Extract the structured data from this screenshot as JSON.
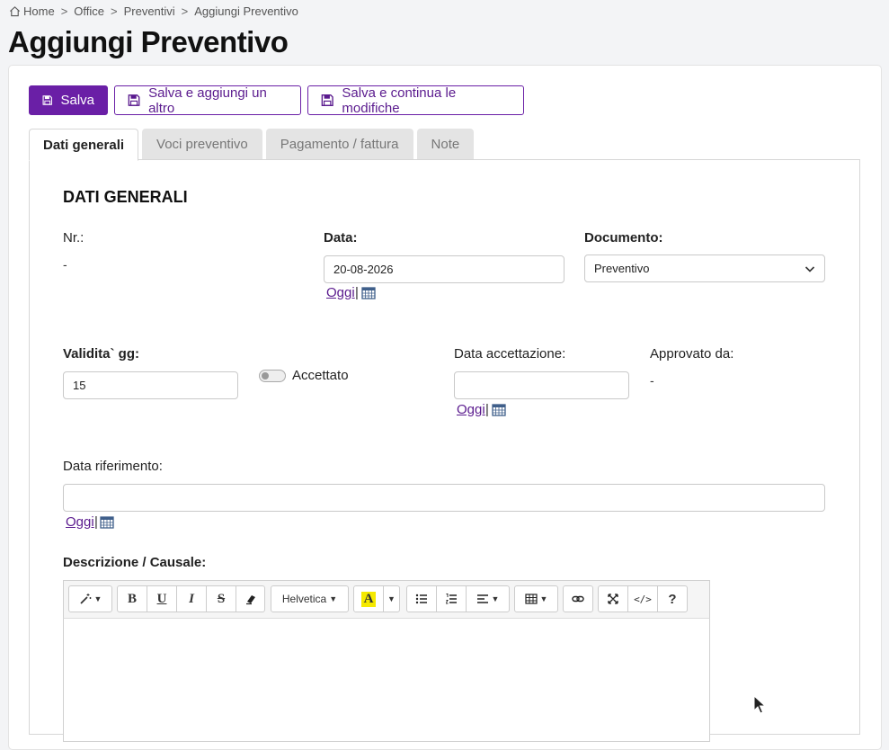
{
  "breadcrumb": [
    "Home",
    "Office",
    "Preventivi",
    "Aggiungi Preventivo"
  ],
  "page_title": "Aggiungi Preventivo",
  "actions": {
    "save": "Salva",
    "save_add": "Salva e aggiungi un altro",
    "save_continue": "Salva e continua le modifiche"
  },
  "tabs": [
    "Dati generali",
    "Voci preventivo",
    "Pagamento / fattura",
    "Note"
  ],
  "section_title": "DATI GENERALI",
  "fields": {
    "nr_label": "Nr.:",
    "nr_value": "-",
    "data_label": "Data:",
    "data_value": "20-08-2026",
    "documento_label": "Documento:",
    "documento_value": "Preventivo",
    "validita_label": "Validita` gg:",
    "validita_value": "15",
    "accettato_label": "Accettato",
    "data_accettazione_label": "Data accettazione:",
    "approvato_label": "Approvato da:",
    "approvato_value": "-",
    "data_riferimento_label": "Data riferimento:",
    "descrizione_label": "Descrizione / Causale:",
    "oggi": "Oggi",
    "pipe": "|"
  },
  "editor": {
    "font_name": "Helvetica",
    "bold": "B",
    "underline": "U",
    "italic": "I",
    "strike": "S",
    "color": "A",
    "code": "</>",
    "help": "?"
  },
  "colors": {
    "primary": "#6a1fa6",
    "link": "#5a1a8e"
  }
}
